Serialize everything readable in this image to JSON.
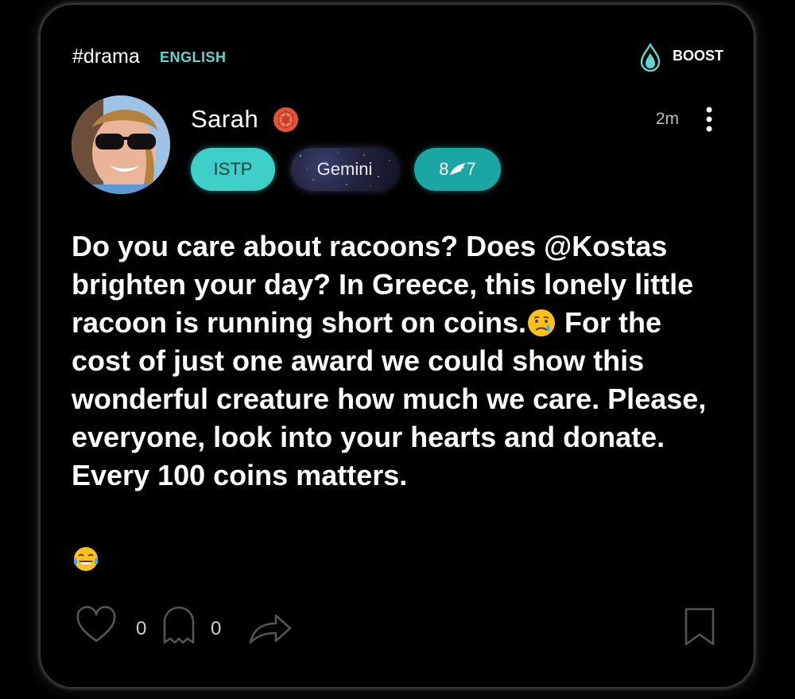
{
  "post": {
    "hashtag": "#drama",
    "language": "ENGLISH",
    "boost_label": "BOOST",
    "time": "2m",
    "body": "Do you care about racoons? Does @Kostas brighten your day? In Greece, this lonely little racoon is running short on coins.",
    "body_rest": " For the cost of just one award we could show this wonderful creature how much we care. Please, everyone, look into your hearts and donate. Every 100 coins matters.",
    "like_count": "0",
    "comment_count": "0"
  },
  "user": {
    "name": "Sarah",
    "mbti": "ISTP",
    "zodiac": "Gemini",
    "enneagram_core": "8",
    "enneagram_wing": "7"
  },
  "icons": {
    "boost": "flame-drop-icon",
    "badge": "red-gem-badge-icon",
    "more": "vertical-dots-icon",
    "wing": "wing-icon",
    "crying": "crying-face-emoji",
    "laughing": "tears-of-joy-emoji",
    "like": "heart-outline-icon",
    "comment": "ghost-bubble-icon",
    "share": "share-arrow-icon",
    "save": "bookmark-outline-icon"
  },
  "colors": {
    "accent_teal": "#63d3d0",
    "mbti_pill": "#3fcfc9",
    "enneagram_pill": "#1aa6a3",
    "badge_red": "#e2553a"
  }
}
